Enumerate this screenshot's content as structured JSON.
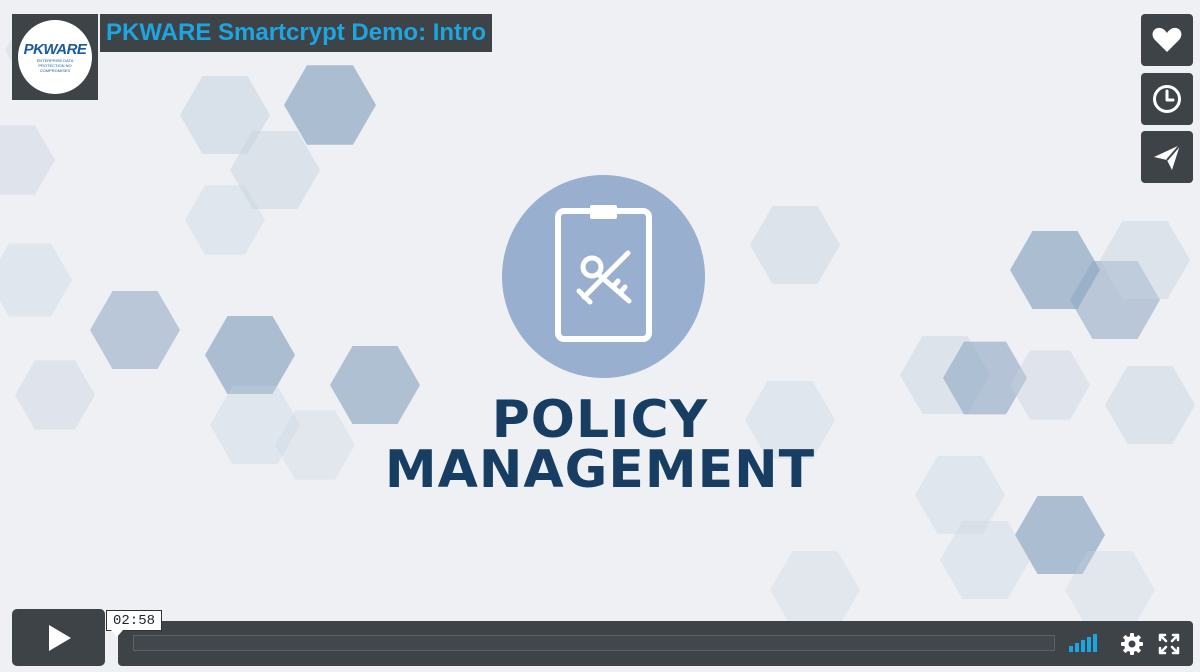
{
  "video": {
    "title": "PKWARE Smartcrypt Demo: Intro",
    "current_time": "02:58",
    "progress_fraction": 0
  },
  "logo": {
    "wordmark": "PKWARE",
    "tagline": "ENTERPRISE DATA PROTECTION NO COMPROMISES"
  },
  "slide": {
    "headline_line1": "POLICY",
    "headline_line2": "MANAGEMENT",
    "icon": "clipboard-keys-icon"
  },
  "side_actions": {
    "like_icon": "heart-icon",
    "later_icon": "clock-icon",
    "share_icon": "paper-plane-icon"
  },
  "controls": {
    "play_icon": "play-icon",
    "volume_icon": "volume-bars-icon",
    "settings_icon": "gear-icon",
    "fullscreen_icon": "fullscreen-icon"
  },
  "colors": {
    "accent": "#1ea5e0",
    "chrome": "#3d4347",
    "headline": "#183d62",
    "hex_light": "#c7d3e0",
    "hex_mid": "#8ea6c2",
    "circle": "#98afd0"
  }
}
